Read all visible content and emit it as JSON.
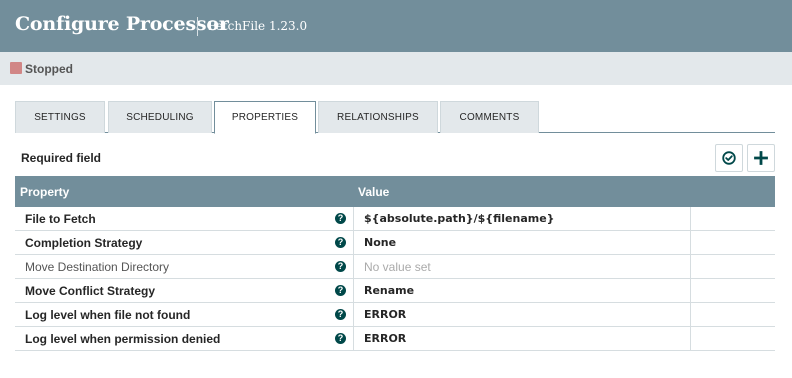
{
  "header": {
    "title": "Configure Processor",
    "subtitle": "FetchFile 1.23.0"
  },
  "status": {
    "label": "Stopped",
    "color": "#d18686"
  },
  "tabs": [
    {
      "label": "SETTINGS",
      "active": false
    },
    {
      "label": "SCHEDULING",
      "active": false
    },
    {
      "label": "PROPERTIES",
      "active": true
    },
    {
      "label": "RELATIONSHIPS",
      "active": false
    },
    {
      "label": "COMMENTS",
      "active": false
    }
  ],
  "properties_panel": {
    "required_label": "Required field",
    "verify_icon": "check-circle-icon",
    "add_icon": "plus-icon",
    "columns": {
      "property": "Property",
      "value": "Value"
    },
    "rows": [
      {
        "name": "File to Fetch",
        "value": "${absolute.path}/${filename}",
        "required": true,
        "has_value": true
      },
      {
        "name": "Completion Strategy",
        "value": "None",
        "required": true,
        "has_value": true
      },
      {
        "name": "Move Destination Directory",
        "value": "No value set",
        "required": false,
        "has_value": false
      },
      {
        "name": "Move Conflict Strategy",
        "value": "Rename",
        "required": true,
        "has_value": true
      },
      {
        "name": "Log level when file not found",
        "value": "ERROR",
        "required": true,
        "has_value": true
      },
      {
        "name": "Log level when permission denied",
        "value": "ERROR",
        "required": true,
        "has_value": true
      }
    ],
    "help_icon": "question-circle-icon"
  },
  "colors": {
    "header": "#728e9b",
    "status_bar": "#e3e8eb",
    "help_icon": "#004849"
  }
}
